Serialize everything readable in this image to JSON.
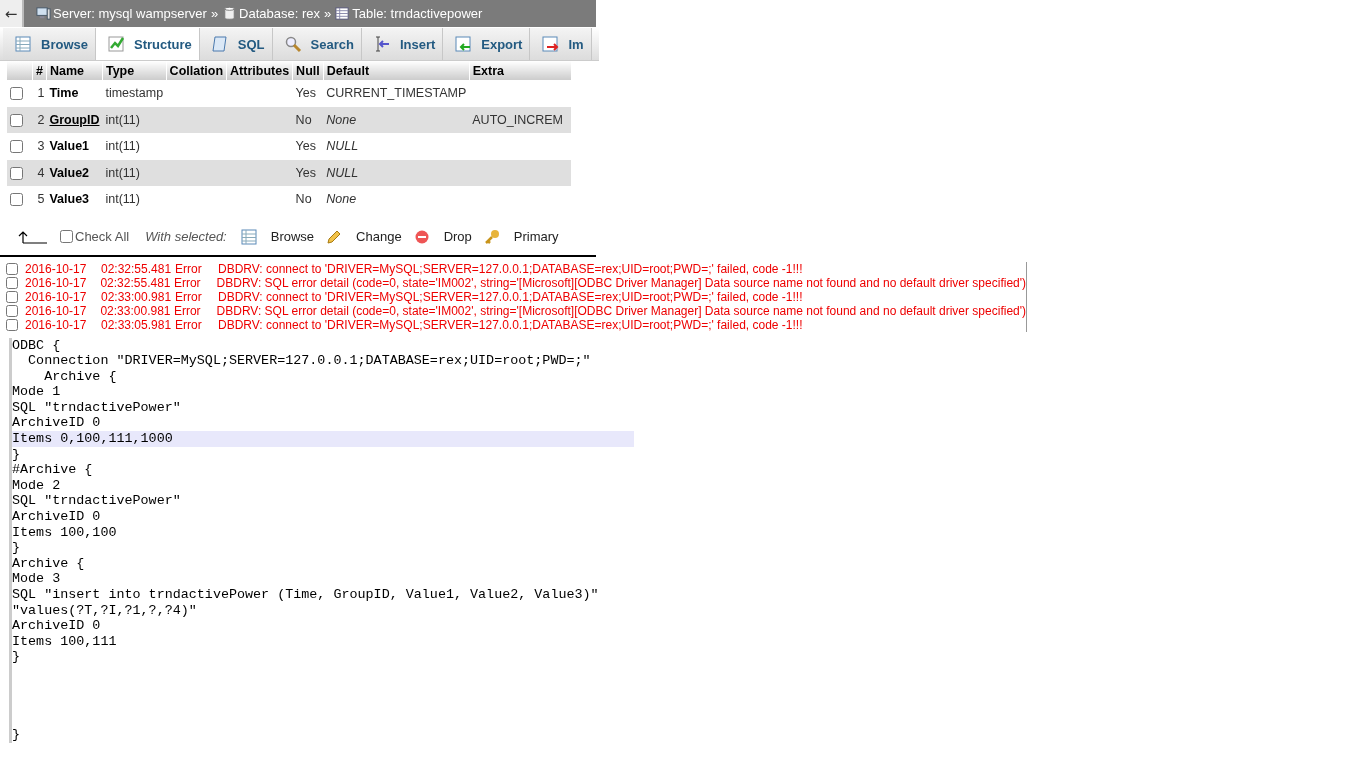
{
  "breadcrumb": {
    "back": "←",
    "items": [
      {
        "kind": "server",
        "label": "Server: mysql wampserver"
      },
      {
        "kind": "sep",
        "label": "»"
      },
      {
        "kind": "database",
        "label": "Database: rex"
      },
      {
        "kind": "sep",
        "label": "»"
      },
      {
        "kind": "table",
        "label": "Table: trndactivepower"
      }
    ]
  },
  "tabs": [
    {
      "kind": "browse",
      "label": "Browse",
      "selected": false
    },
    {
      "kind": "structure",
      "label": "Structure",
      "selected": true
    },
    {
      "kind": "sql",
      "label": "SQL",
      "selected": false
    },
    {
      "kind": "search",
      "label": "Search",
      "selected": false
    },
    {
      "kind": "insert",
      "label": "Insert",
      "selected": false
    },
    {
      "kind": "export",
      "label": "Export",
      "selected": false
    },
    {
      "kind": "import",
      "label": "Im",
      "selected": false
    }
  ],
  "table": {
    "columns": [
      "#",
      "Name",
      "Type",
      "Collation",
      "Attributes",
      "Null",
      "Default",
      "Extra"
    ],
    "rows": [
      {
        "checked": false,
        "num": "1",
        "name": "Time",
        "primary": false,
        "type": "timestamp",
        "null": "Yes",
        "default": "CURRENT_TIMESTAMP",
        "default_italic": false
      },
      {
        "checked": false,
        "num": "2",
        "name": "GroupID",
        "primary": true,
        "type": "int(11)",
        "null": "No",
        "default": "None",
        "default_italic": true,
        "extra": "AUTO_INCREM"
      },
      {
        "checked": false,
        "num": "3",
        "name": "Value1",
        "primary": false,
        "type": "int(11)",
        "null": "Yes",
        "default": "NULL",
        "default_italic": true
      },
      {
        "checked": false,
        "num": "4",
        "name": "Value2",
        "primary": false,
        "type": "int(11)",
        "null": "Yes",
        "default": "NULL",
        "default_italic": true
      },
      {
        "checked": false,
        "num": "5",
        "name": "Value3",
        "primary": false,
        "type": "int(11)",
        "null": "No",
        "default": "None",
        "default_italic": true
      }
    ]
  },
  "footer": {
    "check_all": {
      "label": "Check All",
      "checked": false
    },
    "with_selected": "With selected:",
    "actions": [
      {
        "kind": "browse",
        "label": "Browse"
      },
      {
        "kind": "change",
        "label": "Change"
      },
      {
        "kind": "drop",
        "label": "Drop"
      },
      {
        "kind": "primary",
        "label": "Primary"
      }
    ]
  },
  "log": [
    {
      "checked": false,
      "date": "2016-10-17",
      "time": "02:32:55.481",
      "level": "Error",
      "message": "DBDRV: connect to 'DRIVER=MySQL;SERVER=127.0.0.1;DATABASE=rex;UID=root;PWD=;' failed, code -1!!!"
    },
    {
      "checked": false,
      "date": "2016-10-17",
      "time": "02:32:55.481",
      "level": "Error",
      "message": "DBDRV: SQL error detail (code=0, state='IM002', string='[Microsoft][ODBC Driver Manager] Data source name not found and no default driver specified')"
    },
    {
      "checked": false,
      "date": "2016-10-17",
      "time": "02:33:00.981",
      "level": "Error",
      "message": "DBDRV: connect to 'DRIVER=MySQL;SERVER=127.0.0.1;DATABASE=rex;UID=root;PWD=;' failed, code -1!!!"
    },
    {
      "checked": false,
      "date": "2016-10-17",
      "time": "02:33:00.981",
      "level": "Error",
      "message": "DBDRV: SQL error detail (code=0, state='IM002', string='[Microsoft][ODBC Driver Manager] Data source name not found and no default driver specified')"
    },
    {
      "checked": false,
      "date": "2016-10-17",
      "time": "02:33:05.981",
      "level": "Error",
      "message": "DBDRV: connect to 'DRIVER=MySQL;SERVER=127.0.0.1;DATABASE=rex;UID=root;PWD=;' failed, code -1!!!"
    }
  ],
  "code": [
    {
      "kind": "text",
      "text": "ODBC {",
      "highlighted": false
    },
    {
      "kind": "text",
      "text": "  Connection \"DRIVER=MySQL;SERVER=127.0.0.1;DATABASE=rex;UID=root;PWD=;\"",
      "highlighted": false
    },
    {
      "kind": "text",
      "text": "    Archive {",
      "highlighted": false
    },
    {
      "kind": "text",
      "text": "Mode 1",
      "highlighted": false
    },
    {
      "kind": "text",
      "text": "SQL \"trndactivePower\"",
      "highlighted": false
    },
    {
      "kind": "text",
      "text": "ArchiveID 0",
      "highlighted": false
    },
    {
      "kind": "text",
      "text": "Items 0,100,111,1000",
      "highlighted": true
    },
    {
      "kind": "text",
      "text": "}",
      "highlighted": false
    },
    {
      "kind": "text",
      "text": "#Archive {",
      "highlighted": false
    },
    {
      "kind": "text",
      "text": "Mode 2",
      "highlighted": false
    },
    {
      "kind": "text",
      "text": "SQL \"trndactivePower\"",
      "highlighted": false
    },
    {
      "kind": "text",
      "text": "ArchiveID 0",
      "highlighted": false
    },
    {
      "kind": "text",
      "text": "Items 100,100",
      "highlighted": false
    },
    {
      "kind": "text",
      "text": "}",
      "highlighted": false
    },
    {
      "kind": "text",
      "text": "Archive {",
      "highlighted": false
    },
    {
      "kind": "text",
      "text": "Mode 3",
      "highlighted": false
    },
    {
      "kind": "text",
      "text": "SQL \"insert into trndactivePower (Time, GroupID, Value1, Value2, Value3)\"",
      "highlighted": false
    },
    {
      "kind": "text",
      "text": "\"values(?T,?I,?1,?,?4)\"",
      "highlighted": false
    },
    {
      "kind": "text",
      "text": "ArchiveID 0",
      "highlighted": false
    },
    {
      "kind": "text",
      "text": "Items 100,111",
      "highlighted": false
    },
    {
      "kind": "text",
      "text": "}",
      "highlighted": false
    },
    {
      "kind": "blank"
    },
    {
      "kind": "blank"
    },
    {
      "kind": "blank"
    },
    {
      "kind": "blank"
    },
    {
      "kind": "text",
      "text": "}",
      "highlighted": false
    }
  ]
}
